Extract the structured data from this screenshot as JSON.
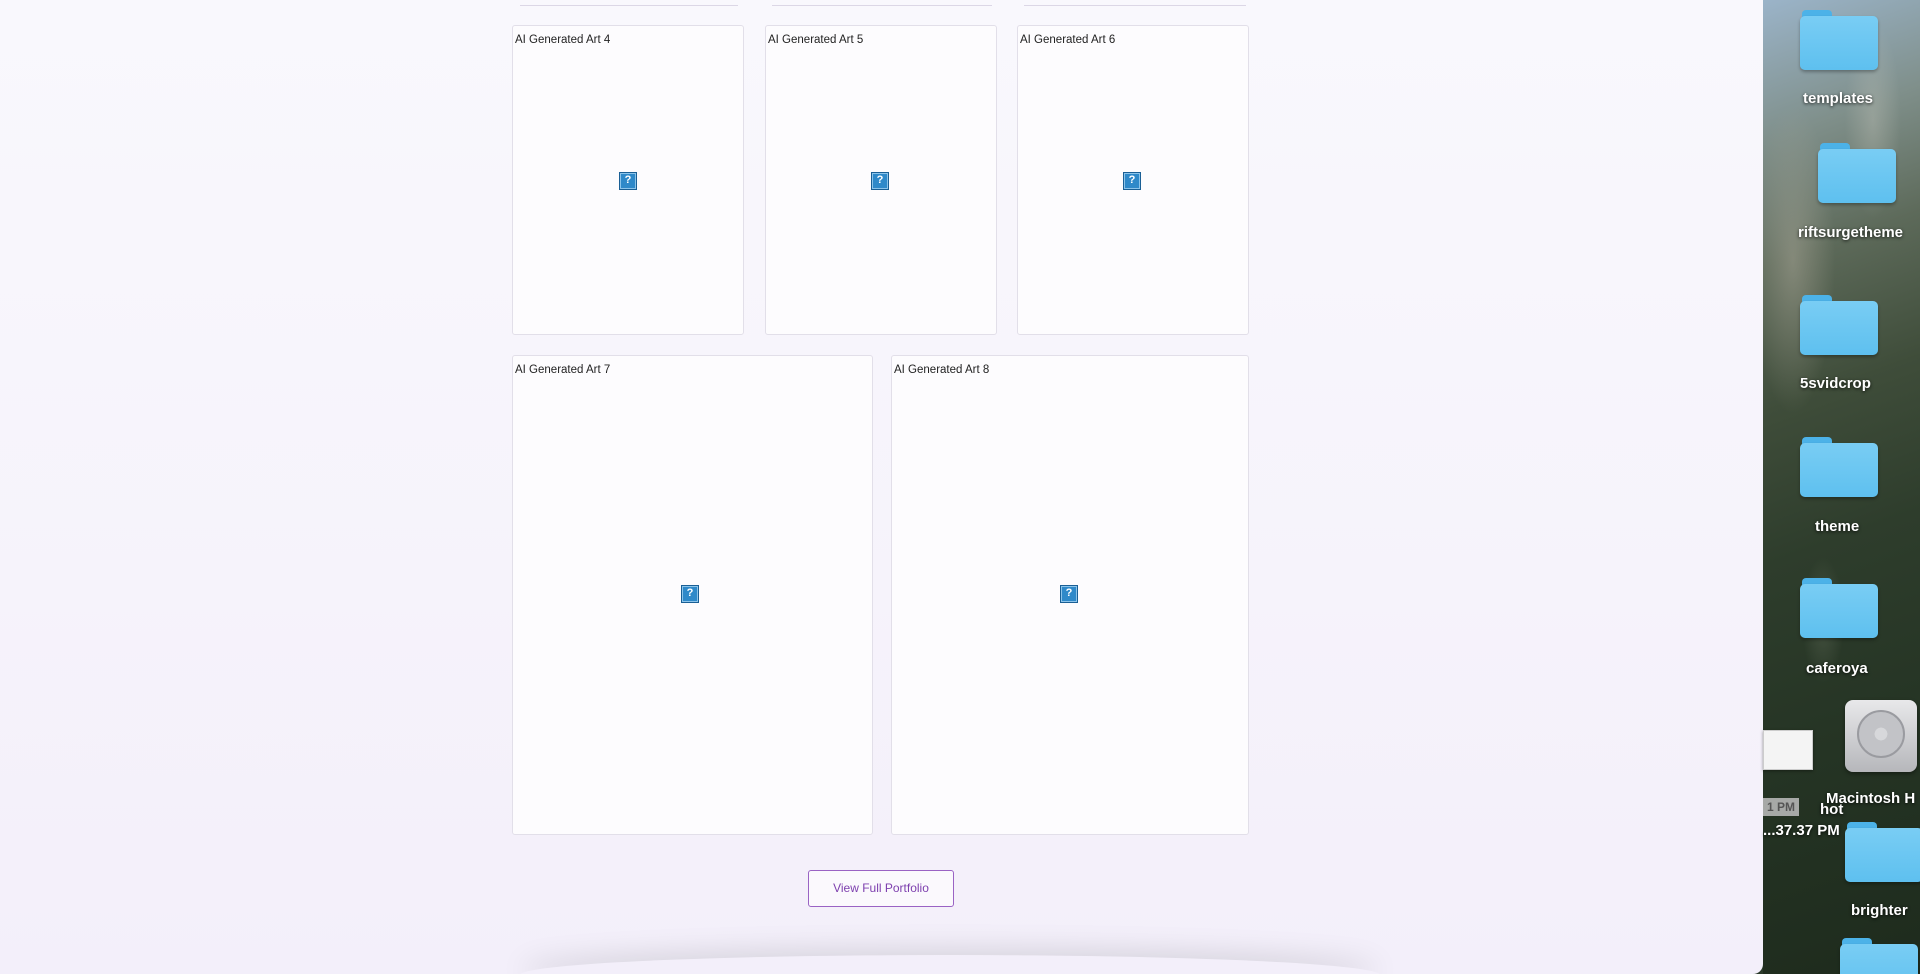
{
  "gallery": {
    "cards": [
      {
        "title": "AI Generated Art 4",
        "image_icon": "broken-image-icon"
      },
      {
        "title": "AI Generated Art 5",
        "image_icon": "broken-image-icon"
      },
      {
        "title": "AI Generated Art 6",
        "image_icon": "broken-image-icon"
      },
      {
        "title": "AI Generated Art 7",
        "image_icon": "broken-image-icon"
      },
      {
        "title": "AI Generated Art 8",
        "image_icon": "broken-image-icon"
      }
    ],
    "broken_glyph": "?",
    "view_button_label": "View Full Portfolio"
  },
  "desktop": {
    "items": [
      {
        "label": "templates",
        "icon": "folder-icon"
      },
      {
        "label": "riftsurgetheme",
        "icon": "folder-icon"
      },
      {
        "label": "5svidcrop",
        "icon": "folder-icon"
      },
      {
        "label": "theme",
        "icon": "folder-icon"
      },
      {
        "label": "caferoya",
        "icon": "folder-icon"
      },
      {
        "label": "Macintosh H",
        "icon": "hard-drive-icon"
      },
      {
        "label": "brighter",
        "icon": "folder-icon"
      },
      {
        "label": "",
        "icon": "folder-icon"
      }
    ],
    "screenshot_label_line1": "hot",
    "screenshot_label_line2": "...37.37 PM",
    "screenshot_time_tag": "1 PM"
  },
  "colors": {
    "accent": "#7d3fae",
    "folder": "#5ec0ef",
    "broken_image": "#2f89c9"
  }
}
